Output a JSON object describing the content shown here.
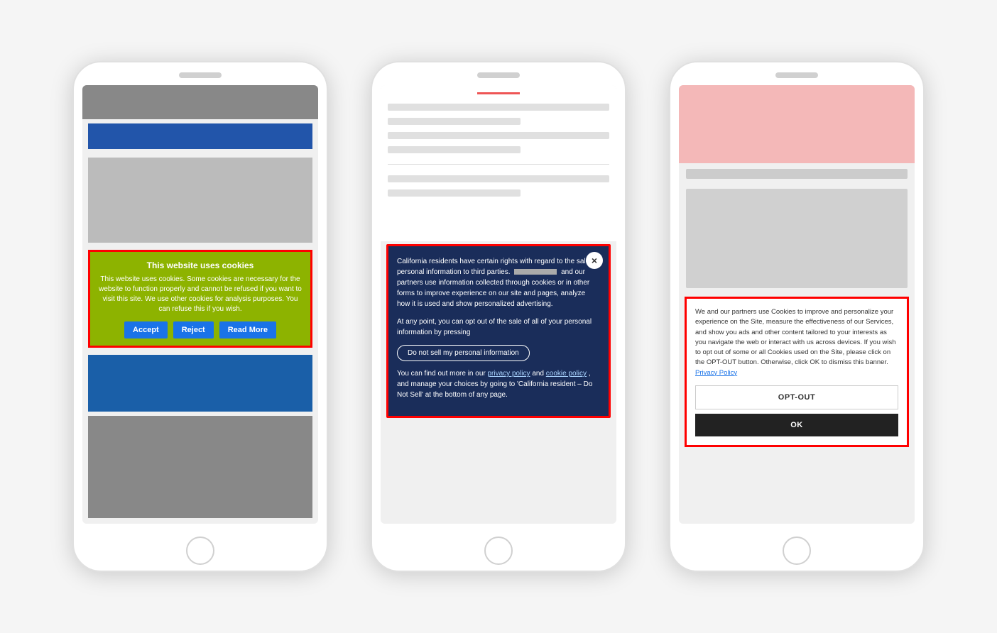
{
  "page": {
    "background": "#f5f5f5"
  },
  "phone1": {
    "cookie_banner": {
      "title": "This website uses cookies",
      "body": "This website uses cookies. Some cookies are necessary for the website to function properly and cannot be refused if you want to visit this site. We use other cookies for analysis purposes. You can refuse this if you wish.",
      "accept_label": "Accept",
      "reject_label": "Reject",
      "read_more_label": "Read More"
    }
  },
  "phone2": {
    "cookie_banner": {
      "body1": "California residents have certain rights with regard to the sale of personal information to third parties.",
      "body2": "and our partners use information collected through cookies or in other forms to improve experience on our site and pages, analyze how it is used and show personalized advertising.",
      "body3": "At any point, you can opt out of the sale of all of your personal information by pressing",
      "opt_out_label": "Do not sell my personal information",
      "body4": "You can find out more in our",
      "privacy_link": "privacy policy",
      "and_text": "and",
      "cookie_link": "cookie policy",
      "body5": ", and manage your choices by going to 'California resident – Do Not Sell' at the bottom of any page.",
      "close_icon": "×"
    }
  },
  "phone3": {
    "cookie_banner": {
      "body": "We and our partners use Cookies to improve and personalize your experience on the Site, measure the effectiveness of our Services, and show you ads and other content tailored to your interests as you navigate the web or interact with us across devices. If you wish to opt out of some or all Cookies used on the Site, please click on the OPT-OUT button. Otherwise, click OK to dismiss this banner.",
      "privacy_link": "Privacy Policy",
      "opt_out_label": "OPT-OUT",
      "ok_label": "OK"
    }
  }
}
